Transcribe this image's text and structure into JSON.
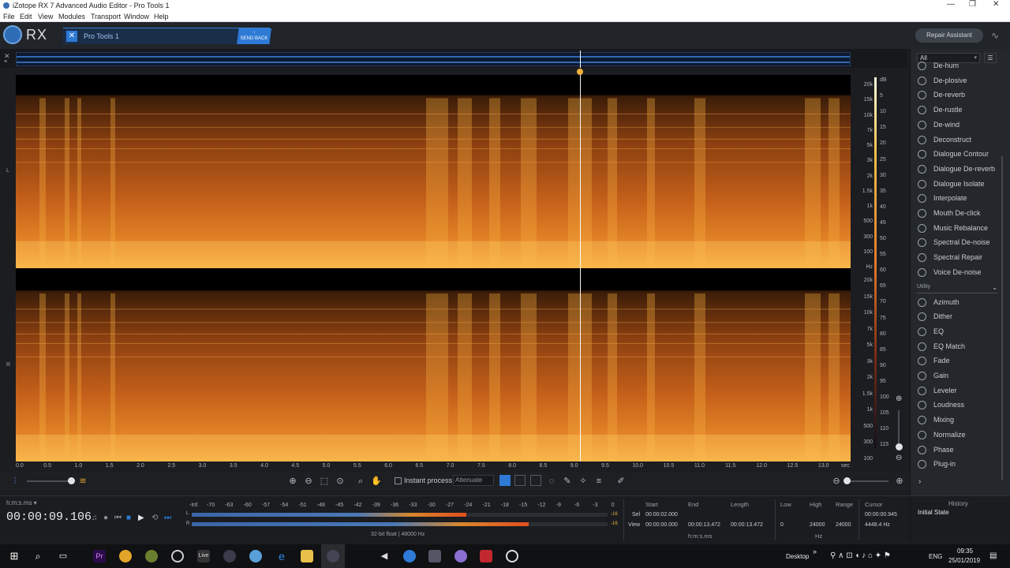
{
  "window": {
    "title": "iZotope RX 7 Advanced Audio Editor - Pro Tools 1",
    "controls": [
      "—",
      "❐",
      "✕"
    ]
  },
  "menu": [
    "File",
    "Edit",
    "View",
    "Modules",
    "Transport",
    "Window",
    "Help"
  ],
  "app": {
    "logo_text": "RX",
    "file_tab": "Pro Tools 1",
    "send_back": "SEND BACK",
    "repair_assistant": "Repair Assistant"
  },
  "spectrogram": {
    "channels": [
      "L",
      "R"
    ],
    "freq_labels_L": [
      "20k",
      "15k",
      "10k",
      "7k",
      "5k",
      "3k",
      "2k",
      "1.5k",
      "1k",
      "500",
      "300",
      "100",
      "Hz"
    ],
    "freq_labels_R": [
      "20k",
      "15k",
      "10k",
      "7k",
      "5k",
      "3k",
      "2k",
      "1.5k",
      "1k",
      "500",
      "300",
      "100"
    ],
    "db_labels": [
      "dB",
      "5",
      "10",
      "15",
      "20",
      "25",
      "30",
      "35",
      "40",
      "45",
      "50",
      "55",
      "60",
      "65",
      "70",
      "75",
      "80",
      "85",
      "90",
      "95",
      "100",
      "105",
      "110",
      "115"
    ],
    "time_labels": [
      "0.0",
      "0.5",
      "1.0",
      "1.5",
      "2.0",
      "2.5",
      "3.0",
      "3.5",
      "4.0",
      "4.5",
      "5.0",
      "5.5",
      "6.0",
      "6.5",
      "7.0",
      "7.5",
      "8.0",
      "8.5",
      "9.0",
      "9.5",
      "10.0",
      "10.5",
      "11.0",
      "11.5",
      "12.0",
      "12.5",
      "13.0",
      "sec"
    ],
    "playhead_seconds": 9.106,
    "duration_seconds": 13.472,
    "colors": {
      "hot": "#ffe08a",
      "mid": "#e07a20",
      "low": "#3b1a06"
    }
  },
  "sidebar": {
    "filter_value": "All",
    "modules_repair": [
      "De-hum",
      "De-plosive",
      "De-reverb",
      "De-rustle",
      "De-wind",
      "Deconstruct",
      "Dialogue Contour",
      "Dialogue De-reverb",
      "Dialogue Isolate",
      "Interpolate",
      "Mouth De-click",
      "Music Rebalance",
      "Spectral De-noise",
      "Spectral Repair",
      "Voice De-noise"
    ],
    "category_utility": "Utility",
    "modules_utility": [
      "Azimuth",
      "Dither",
      "EQ",
      "EQ Match",
      "Fade",
      "Gain",
      "Leveler",
      "Loudness",
      "Mixing",
      "Normalize",
      "Phase",
      "Plug-in"
    ]
  },
  "tools": {
    "instant_process": "Instant process",
    "attenuate": "Attenuate"
  },
  "transport": {
    "format": "h:m:s.ms",
    "timecode": "00:00:09.106",
    "meter_scale": [
      "-Inf.",
      "-70",
      "-63",
      "-60",
      "-57",
      "-54",
      "-51",
      "-48",
      "-45",
      "-42",
      "-39",
      "-36",
      "-33",
      "-30",
      "-27",
      "-24",
      "-21",
      "-18",
      "-15",
      "-12",
      "-9",
      "-6",
      "-3",
      "0"
    ],
    "meter_L_label": "L",
    "meter_R_label": "R",
    "meter_L_level": 0.66,
    "meter_R_level": 0.81,
    "peak_L": "-16",
    "peak_R": "-16",
    "bitrate": "32-bit float | 48000 Hz"
  },
  "selection": {
    "headers": [
      "Start",
      "End",
      "Length"
    ],
    "sel_label": "Sel",
    "sel_start": "00:00:02.000",
    "view_label": "View",
    "view_start": "00:00:00.000",
    "view_end": "00:00:13.472",
    "view_length": "00:00:13.472",
    "unit": "h:m:s.ms",
    "freq_headers": [
      "Low",
      "High",
      "Range"
    ],
    "low": "0",
    "high": "24000",
    "range": "24000",
    "freq_unit": "Hz",
    "cursor_header": "Cursor",
    "cursor_time": "00:00:00.945",
    "cursor_freq": "4448.4 Hz"
  },
  "history": {
    "title": "History",
    "state": "Initial State"
  },
  "taskbar": {
    "desktop": "Desktop",
    "lang": "ENG",
    "time": "09:35",
    "date": "25/01/2019",
    "live_label": "Live",
    "pr_label": "Pr"
  }
}
